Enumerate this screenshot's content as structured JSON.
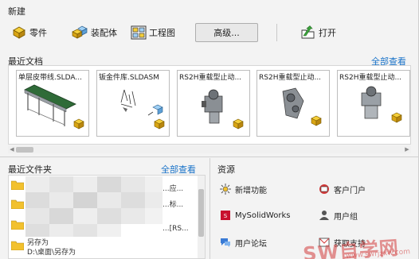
{
  "new": {
    "title": "新建",
    "part_label": "零件",
    "assembly_label": "装配体",
    "drawing_label": "工程图",
    "advanced_label": "高级...",
    "open_label": "打开"
  },
  "recent_docs": {
    "title": "最近文档",
    "view_all": "全部查看",
    "items": [
      {
        "name": "单层皮带线.SLDA..."
      },
      {
        "name": "钣金件库.SLDASM"
      },
      {
        "name": "RS2H重载型止动..."
      },
      {
        "name": "RS2H重载型止动..."
      },
      {
        "name": "RS2H重载型止动..."
      }
    ]
  },
  "recent_folders": {
    "title": "最近文件夹",
    "view_all": "全部查看",
    "rows": [
      {
        "text": "...应..."
      },
      {
        "text": "...标..."
      },
      {
        "text": "...[RS..."
      },
      {
        "text": "另存为"
      },
      {
        "text": "D:\\桌面\\另存为"
      }
    ]
  },
  "resources": {
    "title": "资源",
    "items": [
      {
        "label": "新增功能",
        "icon": "whats-new-icon"
      },
      {
        "label": "客户门户",
        "icon": "customer-portal-icon"
      },
      {
        "label": "MySolidWorks",
        "icon": "mysolidworks-icon"
      },
      {
        "label": "用户组",
        "icon": "user-group-icon"
      },
      {
        "label": "用户论坛",
        "icon": "user-forum-icon"
      },
      {
        "label": "获取支持",
        "icon": "get-support-icon"
      }
    ]
  },
  "watermark": {
    "text": "SW自学网",
    "sub": "www.swrjzxw.com"
  },
  "colors": {
    "link": "#1a73c9",
    "background": "#f3f3f3",
    "accent_yellow": "#f2c12e"
  }
}
